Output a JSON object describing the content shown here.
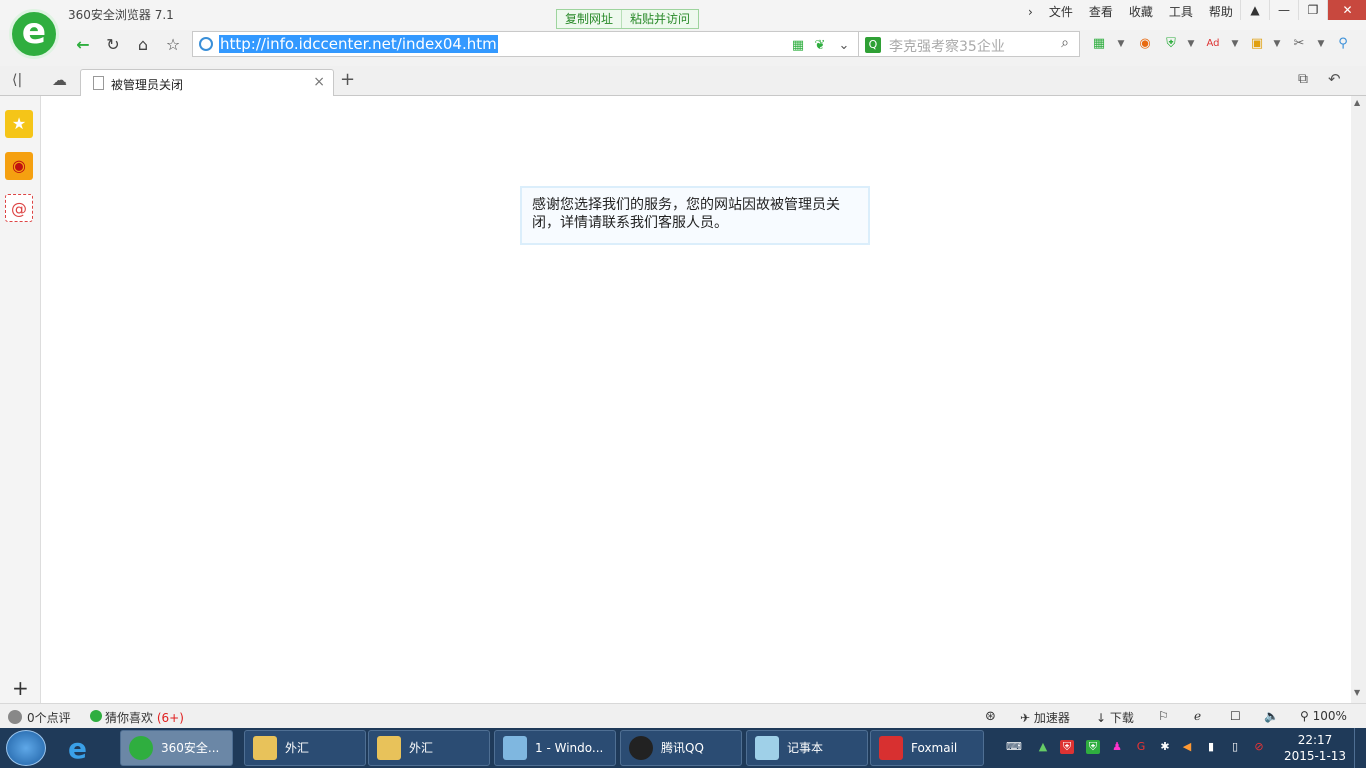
{
  "app": {
    "title": "360安全浏览器 7.1"
  },
  "quick_actions": {
    "copy_url": "复制网址",
    "paste_visit": "粘贴并访问"
  },
  "menus": [
    "文件",
    "查看",
    "收藏",
    "工具",
    "帮助"
  ],
  "address": {
    "url": "http://info.idccenter.net/index04.htm"
  },
  "search": {
    "placeholder": "李克强考察35企业"
  },
  "tab": {
    "title": "被管理员关闭"
  },
  "page": {
    "message": "感谢您选择我们的服务，您的网站因故被管理员关闭，详情请联系我们客服人员。"
  },
  "status": {
    "comments": "0个点评",
    "guess_label": "猜你喜欢",
    "guess_count": "(6+)",
    "accelerator": "加速器",
    "download": "下载",
    "zoom": "100%"
  },
  "taskbar": {
    "items": [
      {
        "label": "360安全..."
      },
      {
        "label": "外汇"
      },
      {
        "label": "外汇"
      },
      {
        "label": "1 - Windo..."
      },
      {
        "label": "腾讯QQ"
      },
      {
        "label": "记事本"
      },
      {
        "label": "Foxmail"
      }
    ],
    "time": "22:17",
    "date": "2015-1-13"
  },
  "colors": {
    "accent_green": "#2fae3f",
    "selection_blue": "#3399ff",
    "guess_red": "#e02020"
  }
}
